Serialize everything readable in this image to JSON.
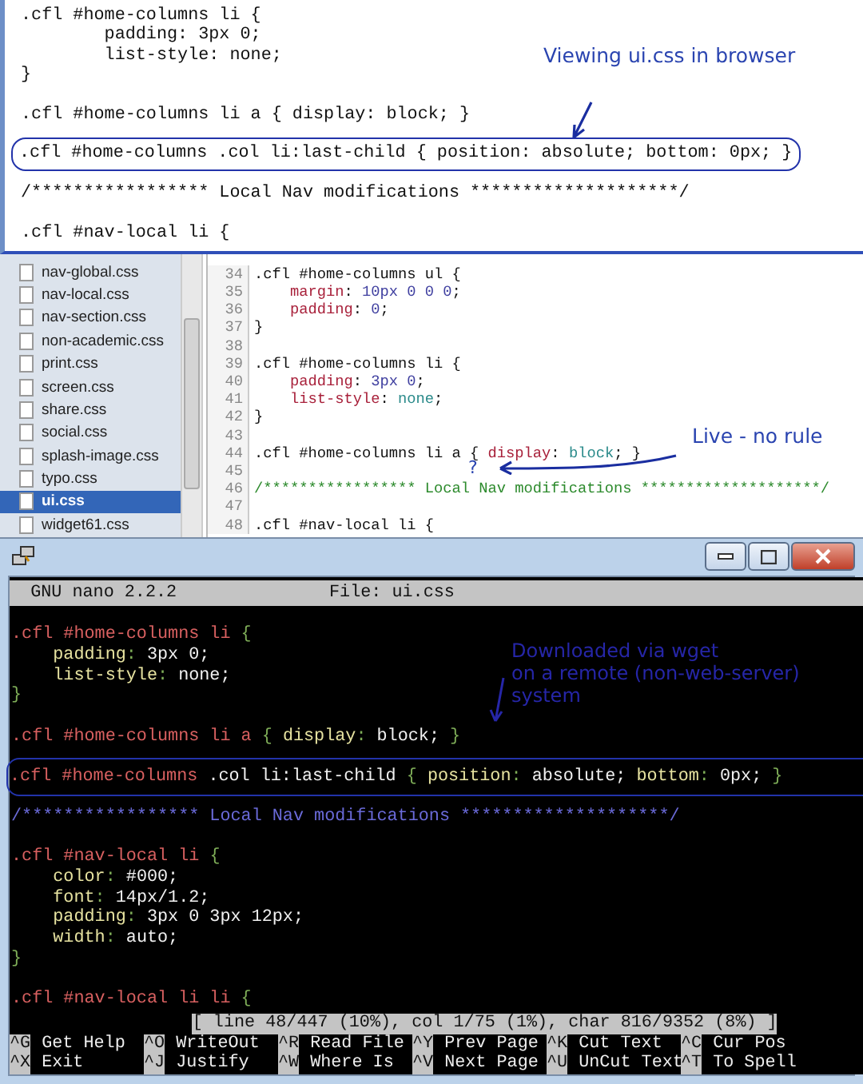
{
  "browser": {
    "annotation": "Viewing ui.css in browser",
    "lines": [
      {
        "text": ".cfl #home-columns li {",
        "gap_before": false,
        "highlighted": false
      },
      {
        "text": "        padding: 3px 0;",
        "gap_before": false,
        "highlighted": false
      },
      {
        "text": "        list-style: none;",
        "gap_before": false,
        "highlighted": false
      },
      {
        "text": "}",
        "gap_before": false,
        "highlighted": false
      },
      {
        "text": ".cfl #home-columns li a { display: block; }",
        "gap_before": true,
        "highlighted": false
      },
      {
        "text": ".cfl #home-columns .col li:last-child { position: absolute; bottom: 0px; }",
        "gap_before": true,
        "highlighted": true
      },
      {
        "text": "/***************** Local Nav modifications ********************/",
        "gap_before": true,
        "highlighted": false
      },
      {
        "text": ".cfl #nav-local li {",
        "gap_before": true,
        "highlighted": false
      }
    ]
  },
  "files": {
    "items": [
      {
        "name": "nav-global.css",
        "selected": false
      },
      {
        "name": "nav-local.css",
        "selected": false
      },
      {
        "name": "nav-section.css",
        "selected": false
      },
      {
        "name": "non-academic.css",
        "selected": false
      },
      {
        "name": "print.css",
        "selected": false
      },
      {
        "name": "screen.css",
        "selected": false
      },
      {
        "name": "share.css",
        "selected": false
      },
      {
        "name": "social.css",
        "selected": false
      },
      {
        "name": "splash-image.css",
        "selected": false
      },
      {
        "name": "typo.css",
        "selected": false
      },
      {
        "name": "ui.css",
        "selected": true
      },
      {
        "name": "widget61.css",
        "selected": false
      }
    ]
  },
  "editor": {
    "annotation": "Live - no rule",
    "question_mark": "?",
    "lines": [
      {
        "number": "34",
        "segments": [
          {
            "kind": "plain",
            "text": ".cfl #home-columns ul {"
          }
        ]
      },
      {
        "number": "35",
        "segments": [
          {
            "kind": "prop",
            "text": "    margin"
          },
          {
            "kind": "plain",
            "text": ": "
          },
          {
            "kind": "num",
            "text": "10px 0 0 0"
          },
          {
            "kind": "plain",
            "text": ";"
          }
        ]
      },
      {
        "number": "36",
        "segments": [
          {
            "kind": "prop",
            "text": "    padding"
          },
          {
            "kind": "plain",
            "text": ": "
          },
          {
            "kind": "num",
            "text": "0"
          },
          {
            "kind": "plain",
            "text": ";"
          }
        ]
      },
      {
        "number": "37",
        "segments": [
          {
            "kind": "plain",
            "text": "}"
          }
        ]
      },
      {
        "number": "38"
      },
      {
        "number": "39",
        "segments": [
          {
            "kind": "plain",
            "text": ".cfl #home-columns li {"
          }
        ]
      },
      {
        "number": "40",
        "segments": [
          {
            "kind": "prop",
            "text": "    padding"
          },
          {
            "kind": "plain",
            "text": ": "
          },
          {
            "kind": "num",
            "text": "3px 0"
          },
          {
            "kind": "plain",
            "text": ";"
          }
        ]
      },
      {
        "number": "41",
        "segments": [
          {
            "kind": "prop",
            "text": "    list-style"
          },
          {
            "kind": "plain",
            "text": ": "
          },
          {
            "kind": "kw",
            "text": "none"
          },
          {
            "kind": "plain",
            "text": ";"
          }
        ]
      },
      {
        "number": "42",
        "segments": [
          {
            "kind": "plain",
            "text": "}"
          }
        ]
      },
      {
        "number": "43"
      },
      {
        "number": "44",
        "segments": [
          {
            "kind": "plain",
            "text": ".cfl #home-columns li a { "
          },
          {
            "kind": "prop",
            "text": "display"
          },
          {
            "kind": "plain",
            "text": ": "
          },
          {
            "kind": "kw",
            "text": "block"
          },
          {
            "kind": "plain",
            "text": "; }"
          }
        ]
      },
      {
        "number": "45"
      },
      {
        "number": "46",
        "segments": [
          {
            "kind": "comment",
            "text": "/***************** Local Nav modifications ********************/"
          }
        ]
      },
      {
        "number": "47"
      },
      {
        "number": "48",
        "segments": [
          {
            "kind": "plain",
            "text": ".cfl #nav-local li {"
          }
        ]
      }
    ]
  },
  "terminal": {
    "program": "GNU nano 2.2.2",
    "file": "File: ui.css",
    "annotation": [
      "Downloaded via wget",
      "on a remote (non-web-server)",
      "system"
    ],
    "lines": [
      {
        "gap_before": true,
        "highlighted": false,
        "segments": [
          {
            "kind": "sel",
            "text": ".cfl #home-columns li "
          },
          {
            "kind": "punct",
            "text": "{"
          }
        ]
      },
      {
        "gap_before": false,
        "highlighted": false,
        "segments": [
          {
            "kind": "prop",
            "text": "    padding"
          },
          {
            "kind": "punct",
            "text": ": "
          },
          {
            "kind": "val",
            "text": "3px 0;"
          }
        ]
      },
      {
        "gap_before": false,
        "highlighted": false,
        "segments": [
          {
            "kind": "prop",
            "text": "    list-style"
          },
          {
            "kind": "punct",
            "text": ": "
          },
          {
            "kind": "val",
            "text": "none;"
          }
        ]
      },
      {
        "gap_before": false,
        "highlighted": false,
        "segments": [
          {
            "kind": "punct",
            "text": "}"
          }
        ]
      },
      {
        "gap_before": true,
        "highlighted": false,
        "segments": [
          {
            "kind": "sel",
            "text": ".cfl #home-columns li a "
          },
          {
            "kind": "punct",
            "text": "{ "
          },
          {
            "kind": "prop",
            "text": "display"
          },
          {
            "kind": "punct",
            "text": ": "
          },
          {
            "kind": "val",
            "text": "block; "
          },
          {
            "kind": "punct",
            "text": "}"
          }
        ]
      },
      {
        "gap_before": true,
        "highlighted": true,
        "segments": [
          {
            "kind": "sel",
            "text": ".cfl #home-columns "
          },
          {
            "kind": "val",
            "text": ".col li:last-child "
          },
          {
            "kind": "punct",
            "text": "{ "
          },
          {
            "kind": "prop",
            "text": "position"
          },
          {
            "kind": "punct",
            "text": ": "
          },
          {
            "kind": "val",
            "text": "absolute; "
          },
          {
            "kind": "prop",
            "text": "bottom"
          },
          {
            "kind": "punct",
            "text": ": "
          },
          {
            "kind": "val",
            "text": "0px; "
          },
          {
            "kind": "punct",
            "text": "}"
          }
        ]
      },
      {
        "gap_before": true,
        "highlighted": false,
        "segments": [
          {
            "kind": "comment",
            "text": "/***************** Local Nav modifications ********************/"
          }
        ]
      },
      {
        "gap_before": true,
        "highlighted": false,
        "segments": [
          {
            "kind": "sel",
            "text": ".cfl #nav-local li "
          },
          {
            "kind": "punct",
            "text": "{"
          }
        ]
      },
      {
        "gap_before": false,
        "highlighted": false,
        "segments": [
          {
            "kind": "prop",
            "text": "    color"
          },
          {
            "kind": "punct",
            "text": ": "
          },
          {
            "kind": "val",
            "text": "#000;"
          }
        ]
      },
      {
        "gap_before": false,
        "highlighted": false,
        "segments": [
          {
            "kind": "prop",
            "text": "    font"
          },
          {
            "kind": "punct",
            "text": ": "
          },
          {
            "kind": "val",
            "text": "14px/1.2;"
          }
        ]
      },
      {
        "gap_before": false,
        "highlighted": false,
        "segments": [
          {
            "kind": "prop",
            "text": "    padding"
          },
          {
            "kind": "punct",
            "text": ": "
          },
          {
            "kind": "val",
            "text": "3px 0 3px 12px;"
          }
        ]
      },
      {
        "gap_before": false,
        "highlighted": false,
        "segments": [
          {
            "kind": "prop",
            "text": "    width"
          },
          {
            "kind": "punct",
            "text": ": "
          },
          {
            "kind": "val",
            "text": "auto;"
          }
        ]
      },
      {
        "gap_before": false,
        "highlighted": false,
        "segments": [
          {
            "kind": "punct",
            "text": "}"
          }
        ]
      },
      {
        "gap_before": true,
        "highlighted": false,
        "segments": [
          {
            "kind": "sel",
            "text": ".cfl #nav-local li li "
          },
          {
            "kind": "punct",
            "text": "{"
          }
        ]
      }
    ],
    "status": "[ line 48/447 (10%), col 1/75 (1%), char 816/9352 (8%) ]",
    "shortcuts": [
      {
        "key": "^G",
        "label": "Get Help"
      },
      {
        "key": "^O",
        "label": "WriteOut"
      },
      {
        "key": "^R",
        "label": "Read File"
      },
      {
        "key": "^Y",
        "label": "Prev Page"
      },
      {
        "key": "^K",
        "label": "Cut Text"
      },
      {
        "key": "^C",
        "label": "Cur Pos"
      },
      {
        "key": "^X",
        "label": "Exit"
      },
      {
        "key": "^J",
        "label": "Justify"
      },
      {
        "key": "^W",
        "label": "Where Is"
      },
      {
        "key": "^V",
        "label": "Next Page"
      },
      {
        "key": "^U",
        "label": "UnCut Text"
      },
      {
        "key": "^T",
        "label": "To Spell"
      }
    ]
  }
}
